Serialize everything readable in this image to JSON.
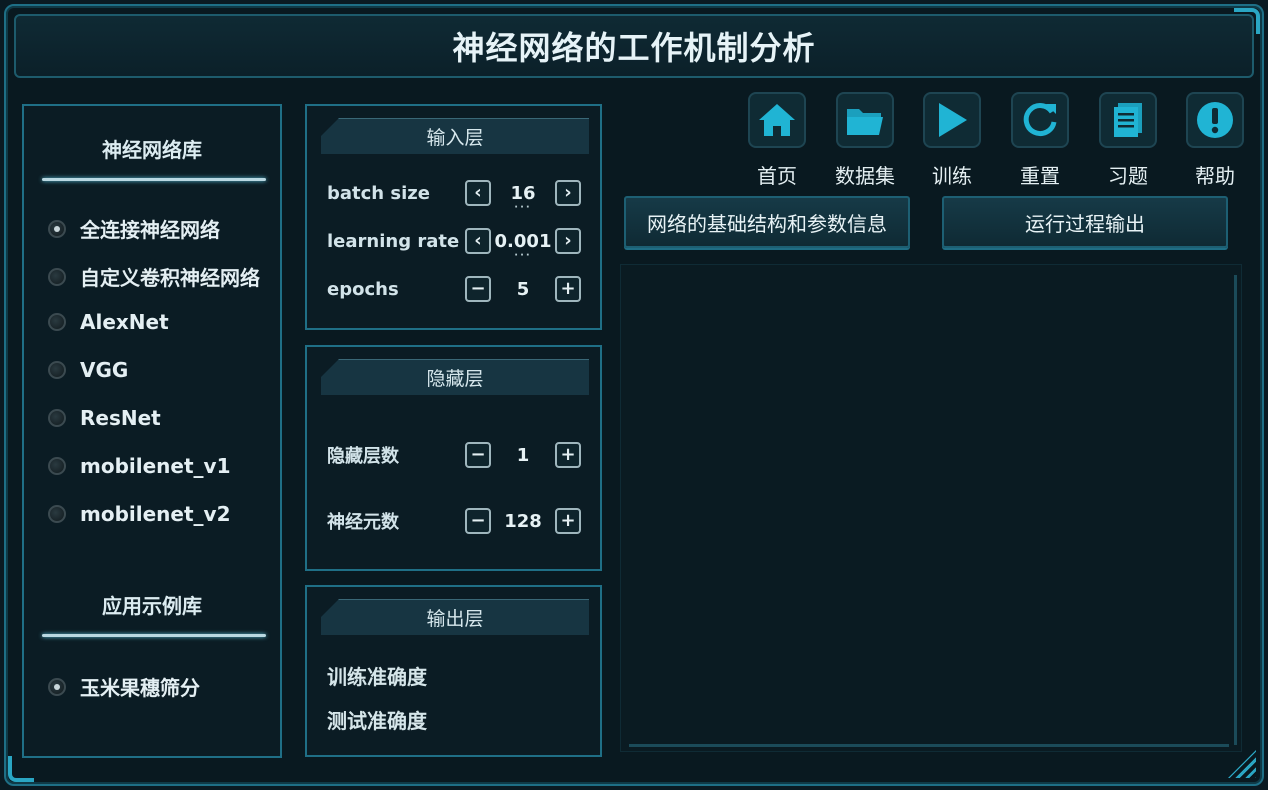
{
  "title": "神经网络的工作机制分析",
  "library": {
    "title": "神经网络库",
    "items": [
      {
        "label": "全连接神经网络",
        "checked": true
      },
      {
        "label": "自定义卷积神经网络",
        "checked": false
      },
      {
        "label": "AlexNet",
        "checked": false
      },
      {
        "label": "VGG",
        "checked": false
      },
      {
        "label": "ResNet",
        "checked": false
      },
      {
        "label": "mobilenet_v1",
        "checked": false
      },
      {
        "label": "mobilenet_v2",
        "checked": false
      }
    ],
    "examples_title": "应用示例库",
    "examples": [
      {
        "label": "玉米果穗筛分",
        "checked": true
      }
    ]
  },
  "input_layer": {
    "title": "输入层",
    "batch_size": {
      "label": "batch size",
      "value": "16"
    },
    "learning_rate": {
      "label": "learning rate",
      "value": "0.001"
    },
    "epochs": {
      "label": "epochs",
      "value": "5"
    }
  },
  "hidden_layer": {
    "title": "隐藏层",
    "layers": {
      "label": "隐藏层数",
      "value": "1"
    },
    "neurons": {
      "label": "神经元数",
      "value": "128"
    }
  },
  "output_layer": {
    "title": "输出层",
    "train_acc": "训练准确度",
    "test_acc": "测试准确度"
  },
  "toolbar": [
    {
      "label": "首页",
      "icon": "home-icon"
    },
    {
      "label": "数据集",
      "icon": "folder-icon"
    },
    {
      "label": "训练",
      "icon": "play-icon"
    },
    {
      "label": "重置",
      "icon": "refresh-icon"
    },
    {
      "label": "习题",
      "icon": "document-icon"
    },
    {
      "label": "帮助",
      "icon": "exclamation-icon"
    }
  ],
  "buttons": {
    "structure": "网络的基础结构和参数信息",
    "run_output": "运行过程输出"
  },
  "colors": {
    "accent": "#1fb5d2",
    "border": "#1f6f86",
    "background": "#091920"
  }
}
